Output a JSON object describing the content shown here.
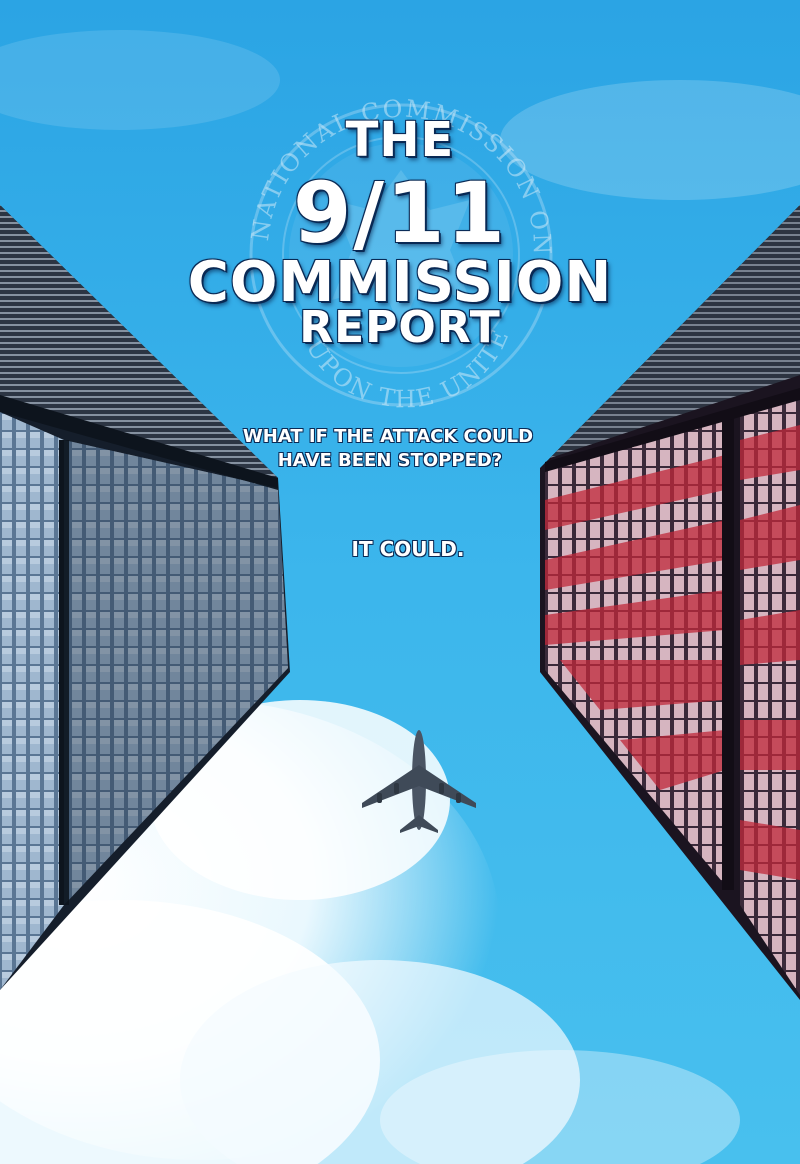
{
  "poster": {
    "title_the": "THE",
    "title_number": "9/11",
    "title_commission": "COMMISSION",
    "title_report": "REPORT",
    "tagline_line1": "WHAT IF THE ATTACK COULD",
    "tagline_line2": "HAVE BEEN STOPPED?",
    "tagline_answer": "IT COULD."
  },
  "seal": {
    "text_top": "NATIONAL COMMISSION ON TERRORIST ATTACKS",
    "text_bottom": "UPON THE UNITED STATES"
  },
  "colors": {
    "sky": "#3db7ec",
    "sky_top": "#2aa6e6",
    "cloud": "#ffffff",
    "building_glass": "#1f2c3e",
    "flag_red": "#c0283a",
    "title_outline": "#0a2a55"
  },
  "icons": {
    "airplane": "airplane-icon",
    "seal": "commission-seal-icon"
  }
}
